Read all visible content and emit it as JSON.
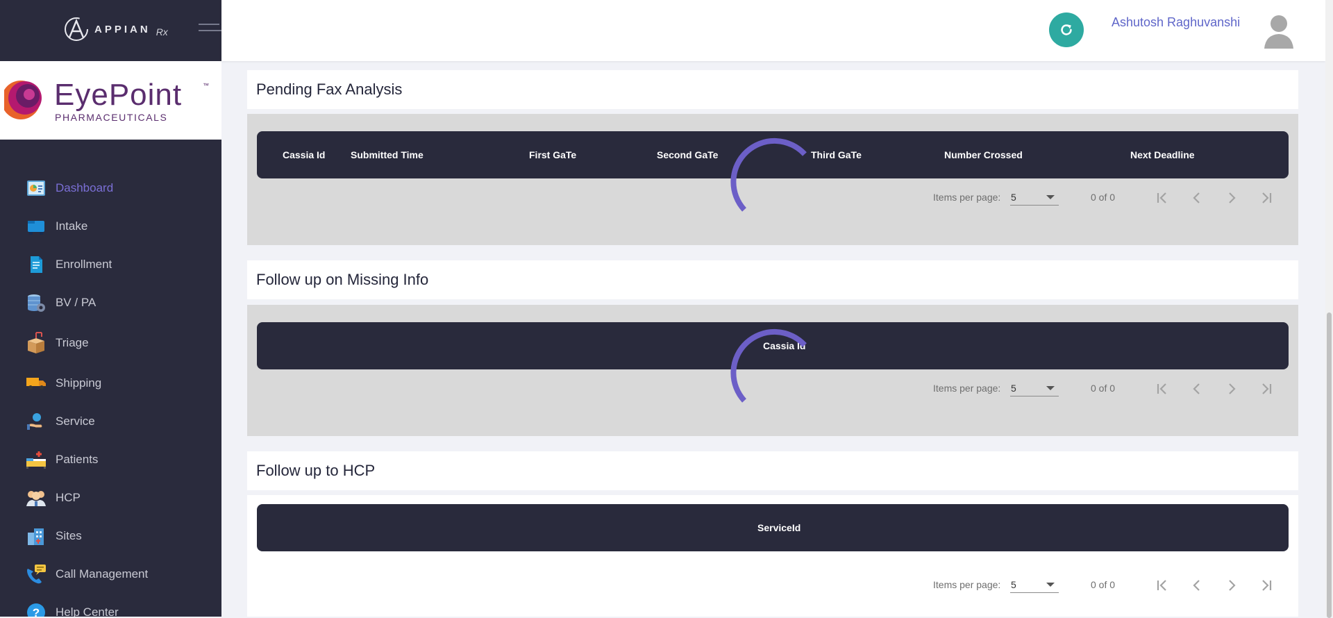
{
  "sidebar": {
    "appian_text": "APPIAN",
    "appian_rx": "Rx",
    "brand_name": "EyePoint",
    "brand_tm": "™",
    "brand_sub": "PHARMACEUTICALS",
    "items": [
      {
        "label": "Dashboard",
        "icon": "dashboard-icon",
        "active": true
      },
      {
        "label": "Intake",
        "icon": "intake-icon"
      },
      {
        "label": "Enrollment",
        "icon": "enrollment-icon"
      },
      {
        "label": "BV / PA",
        "icon": "bv-pa-icon"
      },
      {
        "label": "Triage",
        "icon": "triage-icon"
      },
      {
        "label": "Shipping",
        "icon": "shipping-icon"
      },
      {
        "label": "Service",
        "icon": "service-icon"
      },
      {
        "label": "Patients",
        "icon": "patients-icon"
      },
      {
        "label": "HCP",
        "icon": "hcp-icon"
      },
      {
        "label": "Sites",
        "icon": "sites-icon"
      },
      {
        "label": "Call Management",
        "icon": "call-management-icon"
      },
      {
        "label": "Help Center",
        "icon": "help-center-icon"
      }
    ],
    "active_color": "#7b6fd6"
  },
  "header": {
    "user_name": "Ashutosh Raghuvanshi",
    "refresh_color": "#2eaaa1"
  },
  "sections": [
    {
      "title": "Pending Fax Analysis",
      "columns": [
        "Cassia Id",
        "Submitted Time",
        "First GaTe",
        "Second GaTe",
        "Third GaTe",
        "Number Crossed",
        "Next Deadline"
      ],
      "paginator": {
        "label": "Items per page:",
        "page_size": "5",
        "range": "0 of 0"
      },
      "loading": true
    },
    {
      "title": "Follow up on Missing Info",
      "columns": [
        "Cassia Id"
      ],
      "paginator": {
        "label": "Items per page:",
        "page_size": "5",
        "range": "0 of 0"
      },
      "loading": true
    },
    {
      "title": "Follow up to HCP",
      "columns": [
        "ServiceId"
      ],
      "paginator": {
        "label": "Items per page:",
        "page_size": "5",
        "range": "0 of 0"
      },
      "loading": false
    }
  ]
}
